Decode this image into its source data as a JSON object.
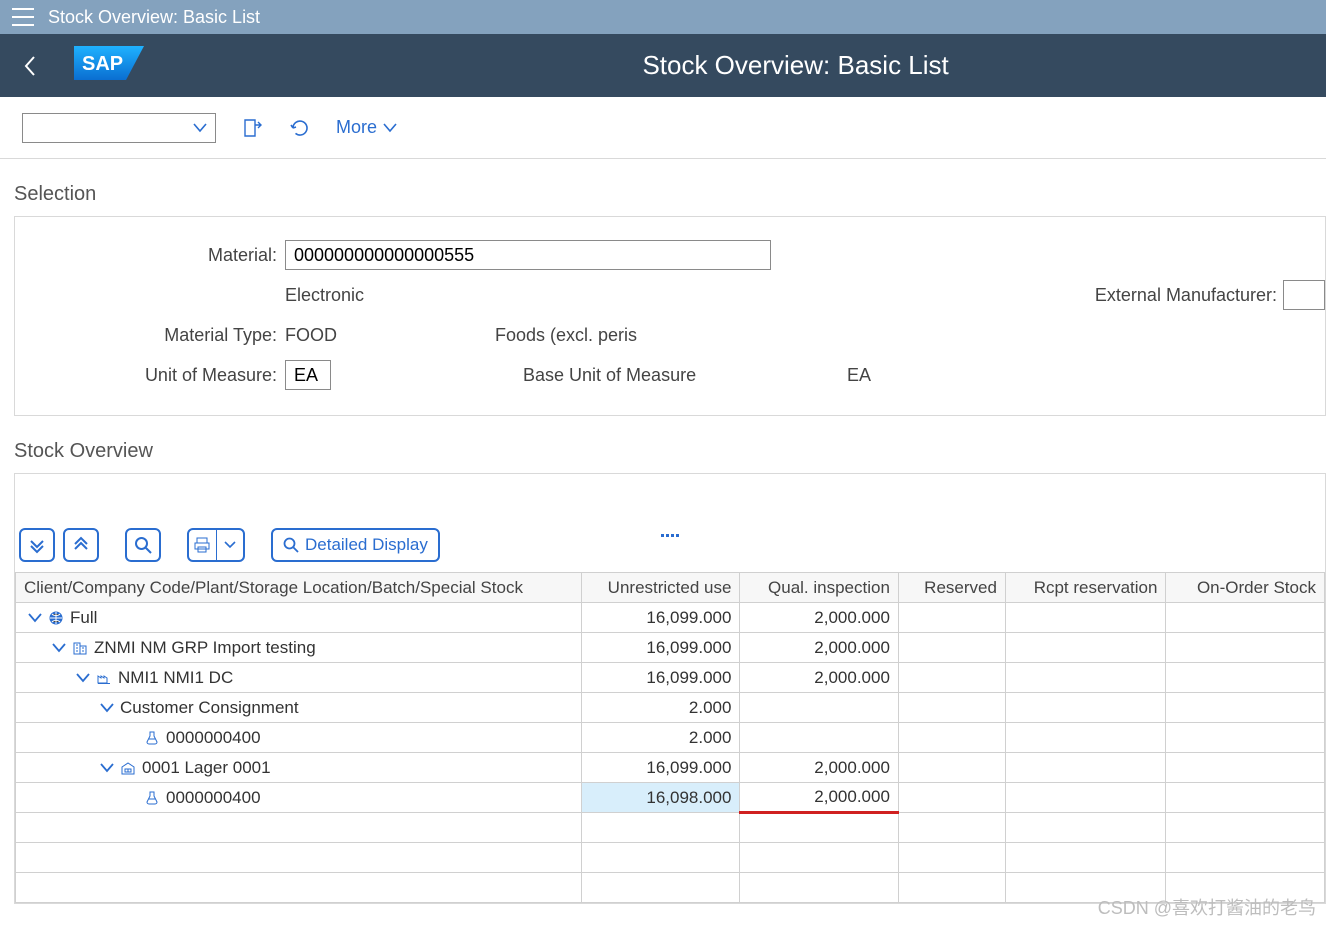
{
  "topbar2": {
    "title": "Stock Overview: Basic List"
  },
  "header": {
    "title": "Stock Overview: Basic List"
  },
  "toolbar": {
    "more": "More"
  },
  "selection": {
    "title": "Selection",
    "material_label": "Material:",
    "material_value": "000000000000000555",
    "description": "Electronic",
    "ext_mfr_label": "External Manufacturer:",
    "ext_mfr_value": "",
    "mat_type_label": "Material Type:",
    "mat_type_value": "FOOD",
    "mat_type_desc": "Foods (excl. peris",
    "uom_label": "Unit of Measure:",
    "uom_value": "EA",
    "uom_desc": "Base Unit of Measure",
    "uom_base": "EA"
  },
  "stock": {
    "title": "Stock Overview",
    "detailed_display": "Detailed Display",
    "columns": {
      "tree": "Client/Company Code/Plant/Storage Location/Batch/Special Stock",
      "unr": "Unrestricted use",
      "qi": "Qual. inspection",
      "res": "Reserved",
      "rcpt": "Rcpt reservation",
      "oos": "On-Order Stock"
    },
    "rows": [
      {
        "indent": 0,
        "chevron": true,
        "icon": "globe",
        "label": "Full",
        "unr": "16,099.000",
        "qi": "2,000.000"
      },
      {
        "indent": 1,
        "chevron": true,
        "icon": "company",
        "label": "ZNMI NM GRP Import testing",
        "unr": "16,099.000",
        "qi": "2,000.000"
      },
      {
        "indent": 2,
        "chevron": true,
        "icon": "plant",
        "label": "NMI1 NMI1 DC",
        "unr": "16,099.000",
        "qi": "2,000.000"
      },
      {
        "indent": 3,
        "chevron": true,
        "icon": "",
        "label": "Customer Consignment",
        "unr": "2.000",
        "qi": ""
      },
      {
        "indent": 4,
        "chevron": false,
        "icon": "batch",
        "label": "0000000400",
        "unr": "2.000",
        "qi": ""
      },
      {
        "indent": 3,
        "chevron": true,
        "icon": "storage",
        "label": "0001 Lager 0001",
        "unr": "16,099.000",
        "qi": "2,000.000"
      },
      {
        "indent": 4,
        "chevron": false,
        "icon": "batch",
        "label": "0000000400",
        "unr": "16,098.000",
        "qi": "2,000.000",
        "highlight": true
      }
    ]
  },
  "watermark": "CSDN @喜欢打酱油的老鸟"
}
